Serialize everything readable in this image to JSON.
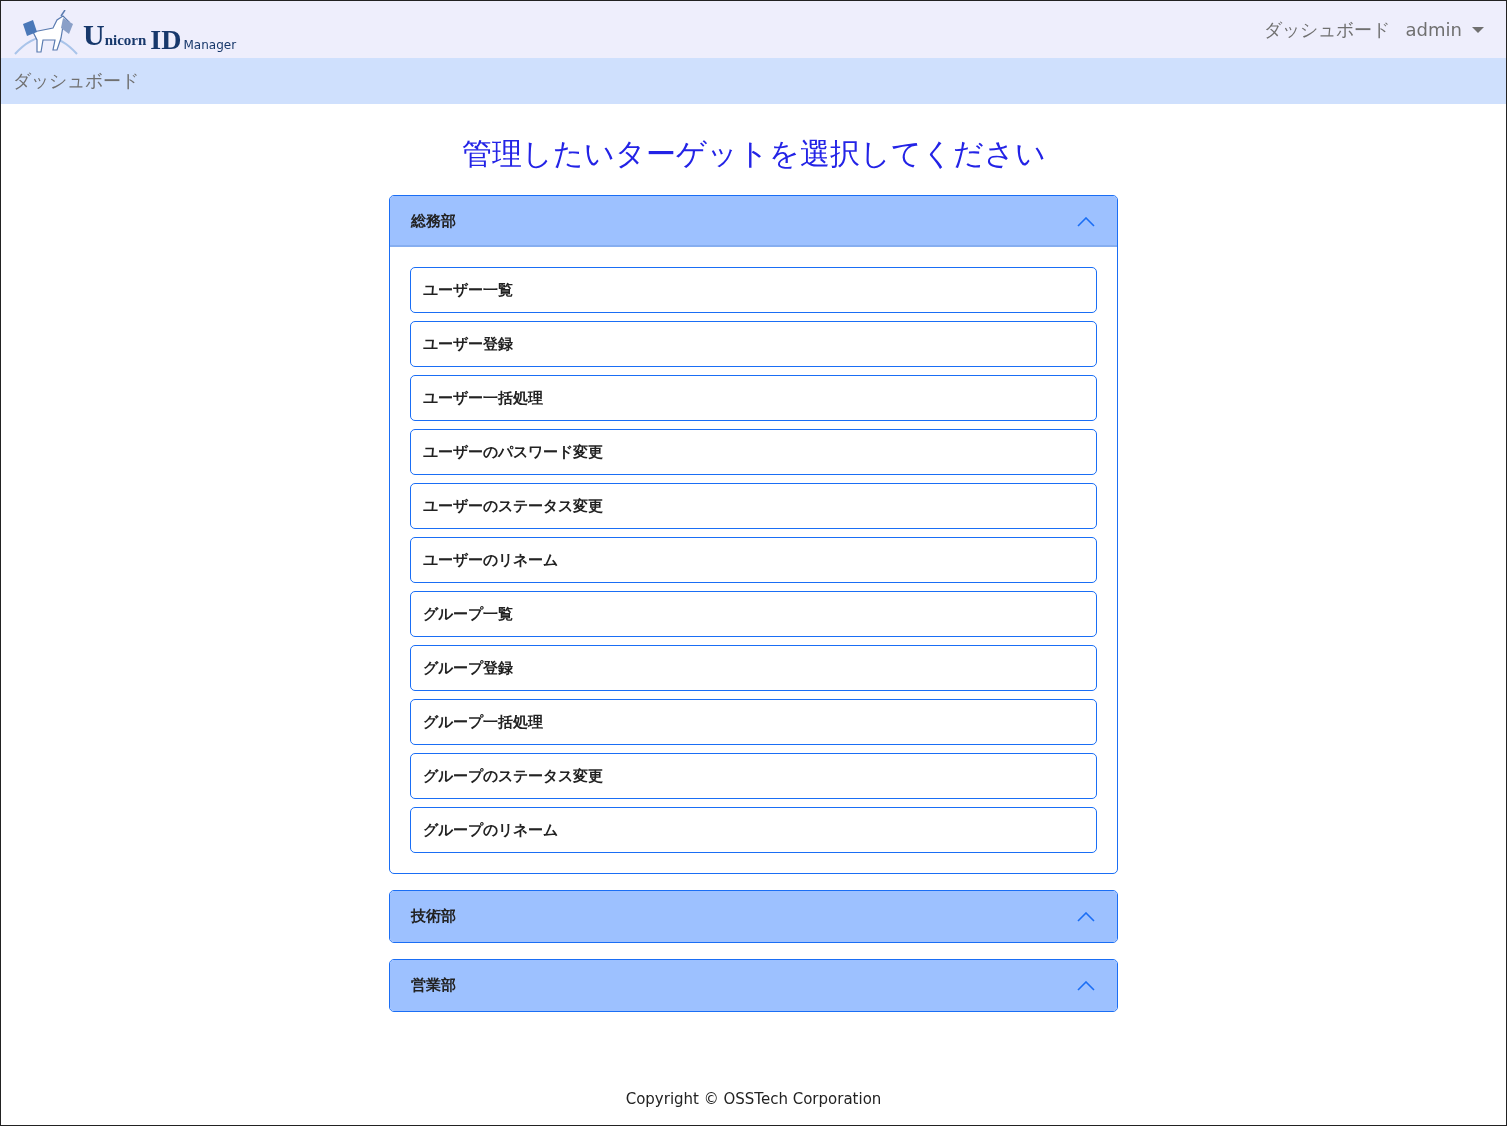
{
  "navbar": {
    "logo": {
      "word1": "Unicorn",
      "word2": "ID",
      "word3": "Manager"
    },
    "links": [
      "ダッシュボード"
    ],
    "user": "admin"
  },
  "breadcrumb": "ダッシュボード",
  "heading": "管理したいターゲットを選択してください",
  "sections": [
    {
      "title": "総務部",
      "expanded": true,
      "items": [
        "ユーザー一覧",
        "ユーザー登録",
        "ユーザー一括処理",
        "ユーザーのパスワード変更",
        "ユーザーのステータス変更",
        "ユーザーのリネーム",
        "グループ一覧",
        "グループ登録",
        "グループ一括処理",
        "グループのステータス変更",
        "グループのリネーム"
      ]
    },
    {
      "title": "技術部",
      "expanded": false
    },
    {
      "title": "営業部",
      "expanded": false
    }
  ],
  "footer": "Copyright © OSSTech Corporation"
}
